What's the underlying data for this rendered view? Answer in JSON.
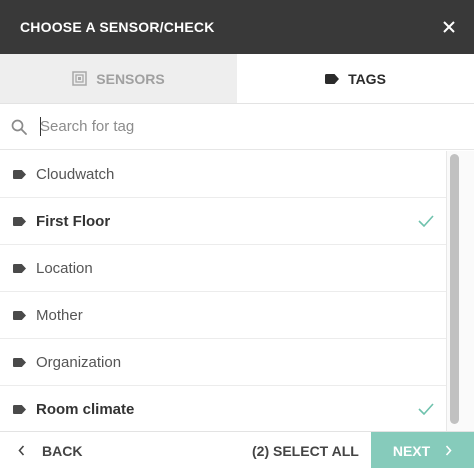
{
  "header": {
    "title": "CHOOSE A SENSOR/CHECK",
    "close_icon": "close-icon"
  },
  "tabs": [
    {
      "label": "SENSORS",
      "icon": "sensor-icon",
      "active": false
    },
    {
      "label": "TAGS",
      "icon": "tag-icon",
      "active": true
    }
  ],
  "search": {
    "placeholder": "Search for tag",
    "value": "",
    "icon": "search-icon"
  },
  "tags": [
    {
      "label": "Cloudwatch",
      "selected": false
    },
    {
      "label": "First Floor",
      "selected": true
    },
    {
      "label": "Location",
      "selected": false
    },
    {
      "label": "Mother",
      "selected": false
    },
    {
      "label": "Organization",
      "selected": false
    },
    {
      "label": "Room climate",
      "selected": true
    }
  ],
  "footer": {
    "back_label": "BACK",
    "select_all_label": "(2) SELECT ALL",
    "next_label": "NEXT"
  },
  "colors": {
    "header_bg": "#393939",
    "accent": "#86cbbb",
    "check": "#6fc2ad"
  }
}
